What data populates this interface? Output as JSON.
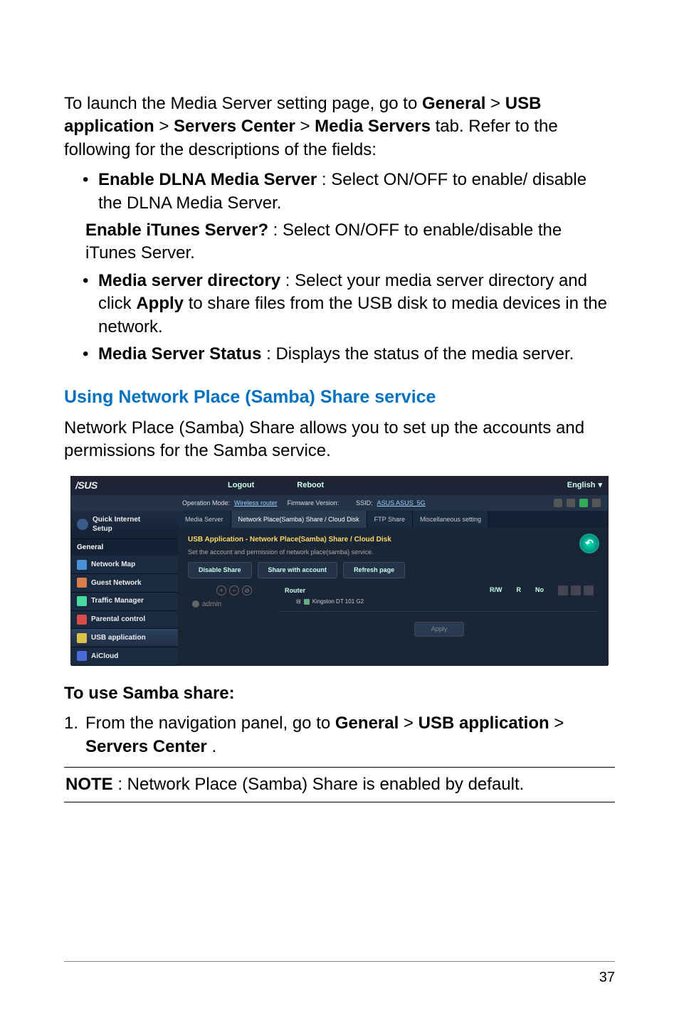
{
  "intro": {
    "prefix": "To launch the Media Server setting page, go to ",
    "b1": "General",
    "gt1": " > ",
    "b2": "USB application",
    "gt2": " > ",
    "b3": "Servers Center",
    "gt3": " > ",
    "b4": "Media Servers",
    "suffix": " tab. Refer to the following for the descriptions of the fields:"
  },
  "bullets": {
    "i1_b": "Enable DLNA Media Server",
    "i1_t": ": Select ON/OFF to enable/ disable the DLNA Media Server.",
    "i2_b": "Enable iTunes Server?",
    "i2_t": ": Select ON/OFF to enable/disable the iTunes Server.",
    "i3_b": "Media server directory",
    "i3_t1": ": Select your media server directory and click ",
    "i3_b2": "Apply",
    "i3_t2": " to share files from the USB disk to media devices in the network.",
    "i4_b": "Media Server Status",
    "i4_t": ": Displays the status of the media server."
  },
  "section_heading": "Using Network Place (Samba) Share service",
  "section_para": "Network Place (Samba) Share allows you to set up the accounts and permissions for the Samba service.",
  "screenshot": {
    "logo": "/SUS",
    "btn_logout": "Logout",
    "btn_reboot": "Reboot",
    "lang": "English",
    "lang_arrow": "▾",
    "info_op_label": "Operation Mode: ",
    "info_op_val": "Wireless router",
    "info_fw_label": "Firmware Version:",
    "info_ssid_label": "SSID: ",
    "info_ssid_val": "ASUS  ASUS_5G",
    "sidebar": {
      "qis1": "Quick Internet",
      "qis2": "Setup",
      "head_general": "General",
      "item_netmap": "Network Map",
      "item_guest": "Guest Network",
      "item_traffic": "Traffic Manager",
      "item_parental": "Parental control",
      "item_usb": "USB application",
      "item_aicloud": "AiCloud"
    },
    "tabs": {
      "t1": "Media Server",
      "t2": "Network Place(Samba) Share / Cloud Disk",
      "t3": "FTP Share",
      "t4": "Miscellaneous setting"
    },
    "panel": {
      "title": "USB Application - Network Place(Samba) Share / Cloud Disk",
      "sub": "Set the account and permission of network place(samba) service.",
      "pill_disable": "Disable Share",
      "pill_share": "Share with account",
      "pill_refresh": "Refresh page",
      "back_arrow": "↶",
      "user_admin": "admin",
      "circ_plus": "+",
      "circ_minus": "−",
      "circ_ban": "⊘",
      "col_router": "Router",
      "col_rw": "R/W",
      "col_r": "R",
      "col_no": "No",
      "folder_item": "Kingston DT 101 G2",
      "apply": "Apply"
    }
  },
  "instr_head": "To use Samba share:",
  "steps": {
    "s1_num": "1.  ",
    "s1_a": "From the navigation panel, go to ",
    "s1_b1": "General",
    "s1_gt1": " > ",
    "s1_b2": "USB application",
    "s1_gt2": " > ",
    "s1_b3": "Servers Center",
    "s1_end": "."
  },
  "note_b": "NOTE",
  "note_t": ":  Network Place (Samba) Share is enabled by default.",
  "page_number": "37"
}
